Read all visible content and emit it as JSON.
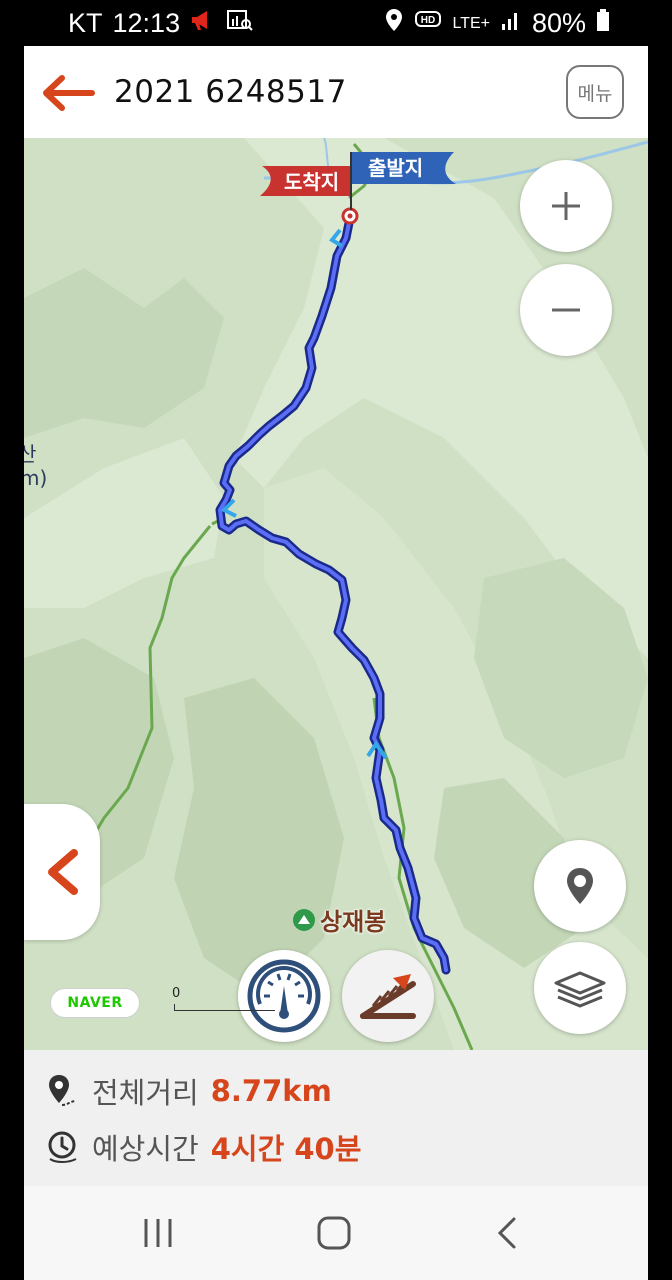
{
  "status_bar": {
    "carrier": "KT",
    "time": "12:13",
    "network": "LTE+",
    "battery": "80%"
  },
  "header": {
    "title": "2021 6248517",
    "menu_label": "메뉴"
  },
  "map": {
    "end_flag_label": "도착지",
    "start_flag_label": "출발지",
    "peak_label": "상재봉",
    "cut_label_top": "산",
    "cut_label_bottom": "m)",
    "provider": "NAVER",
    "scale_label": "0",
    "route_color": "#2b3fd6",
    "trail_color": "#6aa84f",
    "end_flag_color": "#c8322f",
    "start_flag_color": "#2e63b8"
  },
  "info": {
    "distance_label": "전체거리",
    "distance_value": "8.77km",
    "time_label": "예상시간",
    "time_value": "4시간 40분"
  }
}
